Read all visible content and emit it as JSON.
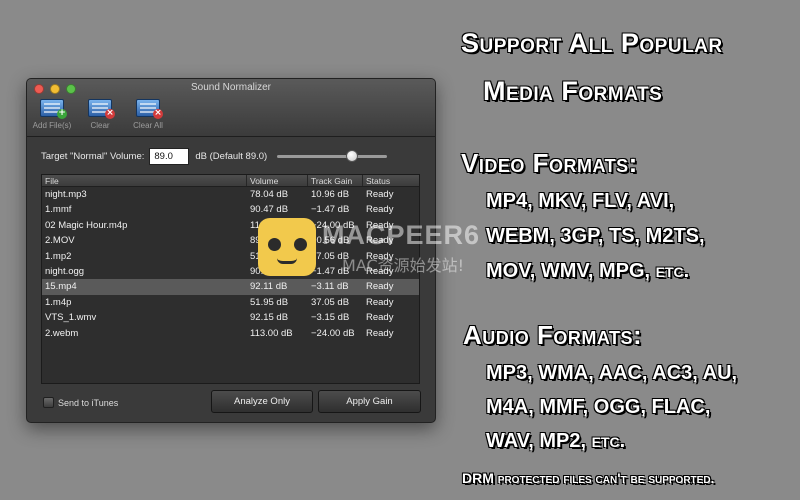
{
  "window": {
    "title": "Sound Normalizer",
    "toolbar": [
      {
        "label": "Add File(s)",
        "icon": "add-file-icon",
        "badge": "+"
      },
      {
        "label": "Clear",
        "icon": "clear-icon",
        "badge": "×"
      },
      {
        "label": "Clear All",
        "icon": "clear-all-icon",
        "badge": "×"
      }
    ],
    "target": {
      "label": "Target \"Normal\" Volume:",
      "value": "89.0",
      "suffix": "dB (Default 89.0)",
      "slider_fraction": 0.68
    },
    "table": {
      "headers": [
        "File",
        "Volume",
        "Track Gain",
        "Status"
      ],
      "rows": [
        {
          "file": "night.mp3",
          "volume": "78.04 dB",
          "gain": "10.96 dB",
          "status": "Ready"
        },
        {
          "file": "1.mmf",
          "volume": "90.47 dB",
          "gain": "−1.47 dB",
          "status": "Ready"
        },
        {
          "file": "02 Magic Hour.m4p",
          "volume": "113.00 dB",
          "gain": "−24.00 dB",
          "status": "Ready"
        },
        {
          "file": "2.MOV",
          "volume": "89.56 dB",
          "gain": "−0.56 dB",
          "status": "Ready"
        },
        {
          "file": "1.mp2",
          "volume": "51.95 dB",
          "gain": "37.05 dB",
          "status": "Ready"
        },
        {
          "file": "night.ogg",
          "volume": "90.47 dB",
          "gain": "−1.47 dB",
          "status": "Ready"
        },
        {
          "file": "15.mp4",
          "volume": "92.11 dB",
          "gain": "−3.11 dB",
          "status": "Ready"
        },
        {
          "file": "1.m4p",
          "volume": "51.95 dB",
          "gain": "37.05 dB",
          "status": "Ready"
        },
        {
          "file": "VTS_1.wmv",
          "volume": "92.15 dB",
          "gain": "−3.15 dB",
          "status": "Ready"
        },
        {
          "file": "2.webm",
          "volume": "113.00 dB",
          "gain": "−24.00 dB",
          "status": "Ready"
        }
      ],
      "selected_index": 6
    },
    "send_to_itunes": "Send to iTunes",
    "analyze_button": "Analyze Only",
    "apply_button": "Apply Gain"
  },
  "watermark": {
    "text": "MACPEER6",
    "subtext": "MAC资源始发站!"
  },
  "marketing": {
    "headline_line1": "Support All Popular",
    "headline_line2": "Media Formats",
    "video_title": "Video Formats:",
    "video_line1": "MP4, MKV, FLV, AVI,",
    "video_line2": "WEBM, 3GP, TS, M2TS,",
    "video_line3": "MOV, WMV, MPG, etc.",
    "audio_title": "Audio Formats:",
    "audio_line1": "MP3, WMA, AAC, AC3, AU,",
    "audio_line2": "M4A, MMF, OGG, FLAC,",
    "audio_line3": "WAV, MP2, etc.",
    "note": "DRM protected files can't be supported."
  },
  "colors": {
    "background": "#8a8a8a",
    "window": "#3a3a3a",
    "selected_row": "#5a5a5a",
    "text": "#ffffff"
  }
}
